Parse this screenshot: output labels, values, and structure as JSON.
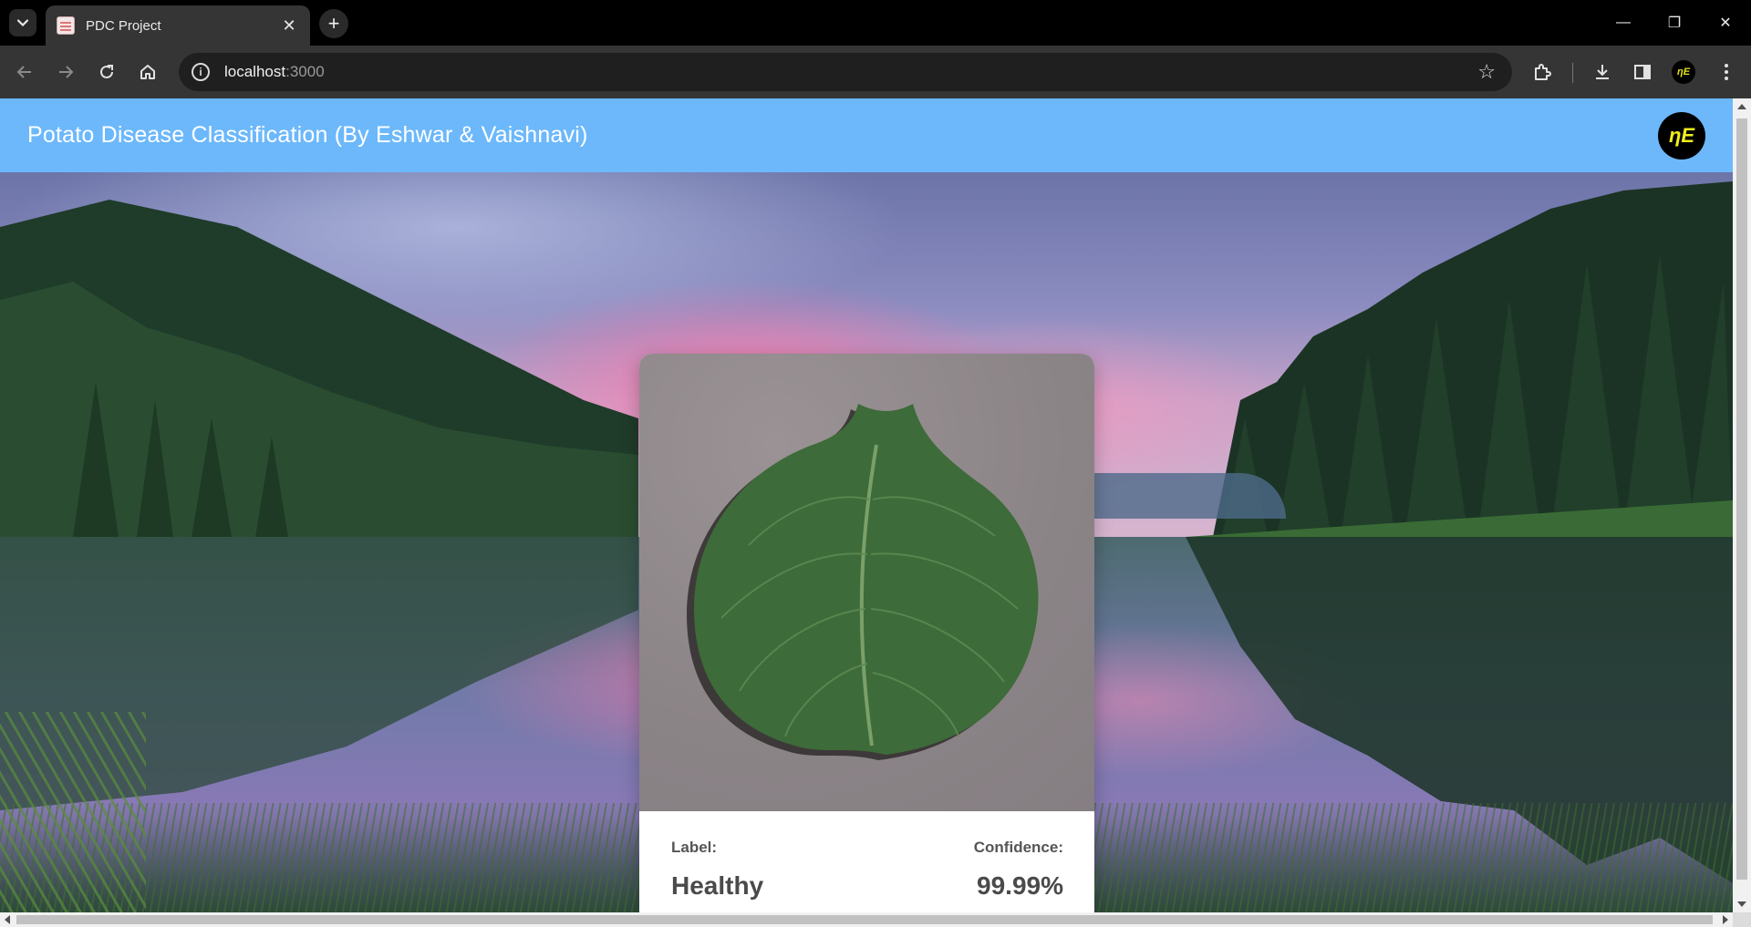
{
  "browser": {
    "tab_title": "PDC Project",
    "tab_close": "✕",
    "new_tab": "+",
    "url_host": "localhost",
    "url_port": ":3000",
    "profile_initials": "ηE",
    "window_controls": {
      "minimize": "—",
      "restore": "❐",
      "close": "✕"
    }
  },
  "app": {
    "title": "Potato Disease Classification (By Eshwar & Vaishnavi)",
    "logo_text": "ηE",
    "header_color": "#6cb8fb"
  },
  "result": {
    "label_heading": "Label:",
    "label_value": "Healthy",
    "confidence_heading": "Confidence:",
    "confidence_value": "99.99%"
  },
  "icons": {
    "tab_search": "chevron-down-icon",
    "back": "arrow-left-icon",
    "forward": "arrow-right-icon",
    "reload": "reload-icon",
    "home": "home-icon",
    "site_info": "info-icon",
    "bookmark": "star-icon",
    "extensions": "puzzle-icon",
    "downloads": "download-icon",
    "side_panel": "side-panel-icon",
    "menu": "kebab-menu-icon"
  }
}
